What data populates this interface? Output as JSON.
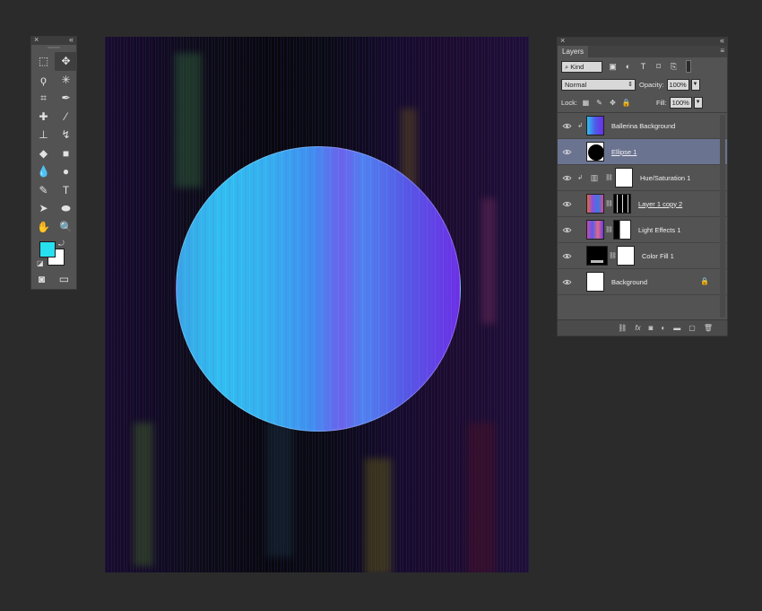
{
  "tools_panel": {
    "close_glyph": "×",
    "collapse_glyph": "«",
    "tools": [
      {
        "name": "marquee-tool-icon",
        "glyph": "⬚"
      },
      {
        "name": "move-tool-icon",
        "glyph": "✥",
        "active": true
      },
      {
        "name": "lasso-tool-icon",
        "glyph": "ϙ"
      },
      {
        "name": "magic-wand-icon",
        "glyph": "✳"
      },
      {
        "name": "crop-tool-icon",
        "glyph": "⌗"
      },
      {
        "name": "eyedropper-icon",
        "glyph": "✒"
      },
      {
        "name": "healing-brush-icon",
        "glyph": "✚"
      },
      {
        "name": "brush-tool-icon",
        "glyph": "⁄"
      },
      {
        "name": "clone-stamp-icon",
        "glyph": "⊥"
      },
      {
        "name": "history-brush-icon",
        "glyph": "↯"
      },
      {
        "name": "eraser-icon",
        "glyph": "◆"
      },
      {
        "name": "gradient-icon",
        "glyph": "■"
      },
      {
        "name": "blur-tool-icon",
        "glyph": "💧"
      },
      {
        "name": "dodge-tool-icon",
        "glyph": "●"
      },
      {
        "name": "pen-tool-icon",
        "glyph": "✎"
      },
      {
        "name": "type-tool-icon",
        "glyph": "T"
      },
      {
        "name": "path-selection-icon",
        "glyph": "➤"
      },
      {
        "name": "ellipse-tool-icon",
        "glyph": "⬬"
      },
      {
        "name": "hand-tool-icon",
        "glyph": "✋"
      },
      {
        "name": "zoom-tool-icon",
        "glyph": "🔍"
      }
    ],
    "foreground_color": "#27e1f0",
    "background_color": "#ffffff"
  },
  "layers_panel": {
    "close_glyph": "×",
    "collapse_glyph": "«",
    "tab_label": "Layers",
    "menu_glyph": "≡",
    "filter_kind": "Kind",
    "blend_mode": "Normal",
    "opacity_label": "Opacity:",
    "opacity_value": "100%",
    "lock_label": "Lock:",
    "fill_label": "Fill:",
    "fill_value": "100%",
    "layers": [
      {
        "name": "Ballerina Background"
      },
      {
        "name": "Ellipse 1"
      },
      {
        "name": "Hue/Saturation 1"
      },
      {
        "name": "Layer 1 copy 2"
      },
      {
        "name": "Light Effects 1"
      },
      {
        "name": "Color Fill 1"
      },
      {
        "name": "Background"
      }
    ],
    "footer_icons": [
      "link-icon",
      "fx-icon",
      "mask-icon",
      "adjustment-icon",
      "group-folder-icon",
      "new-layer-icon",
      "trash-icon"
    ],
    "footer_fx_label": "fx"
  },
  "canvas": {
    "circle_colors": [
      "#2fbff0",
      "#3f8ff0",
      "#6b2fe6"
    ]
  }
}
